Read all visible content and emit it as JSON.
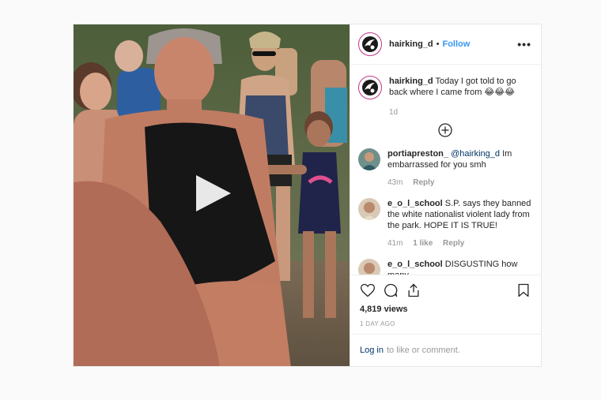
{
  "post": {
    "username": "hairking_d",
    "separator": "•",
    "follow_label": "Follow",
    "more_label": "•••",
    "caption": {
      "username": "hairking_d",
      "text": "Today I got told to go back where I came from 😂😂😂",
      "age": "1d"
    },
    "comments": [
      {
        "username": "portiapreston_",
        "mention": "@hairking_d",
        "text": "Im embarrassed for you smh",
        "age": "43m",
        "reply_label": "Reply"
      },
      {
        "username": "e_o_l_school",
        "text": "S.P. says they banned the white nationalist violent lady from the park. HOPE IT IS TRUE!",
        "age": "41m",
        "likes": "1 like",
        "reply_label": "Reply"
      },
      {
        "username": "e_o_l_school",
        "text": "DISGUSTING how many"
      }
    ],
    "views": "4,819 views",
    "timestamp": "1 DAY AGO",
    "login_link": "Log in",
    "login_text": "to like or comment."
  },
  "icons": {
    "play": "play-icon",
    "like": "heart-icon",
    "comment": "comment-icon",
    "share": "share-icon",
    "save": "bookmark-icon",
    "load_more": "plus-circle-icon"
  },
  "colors": {
    "link": "#3897f0",
    "mention": "#003569",
    "muted": "#999999",
    "story_ring": "#c13584"
  }
}
